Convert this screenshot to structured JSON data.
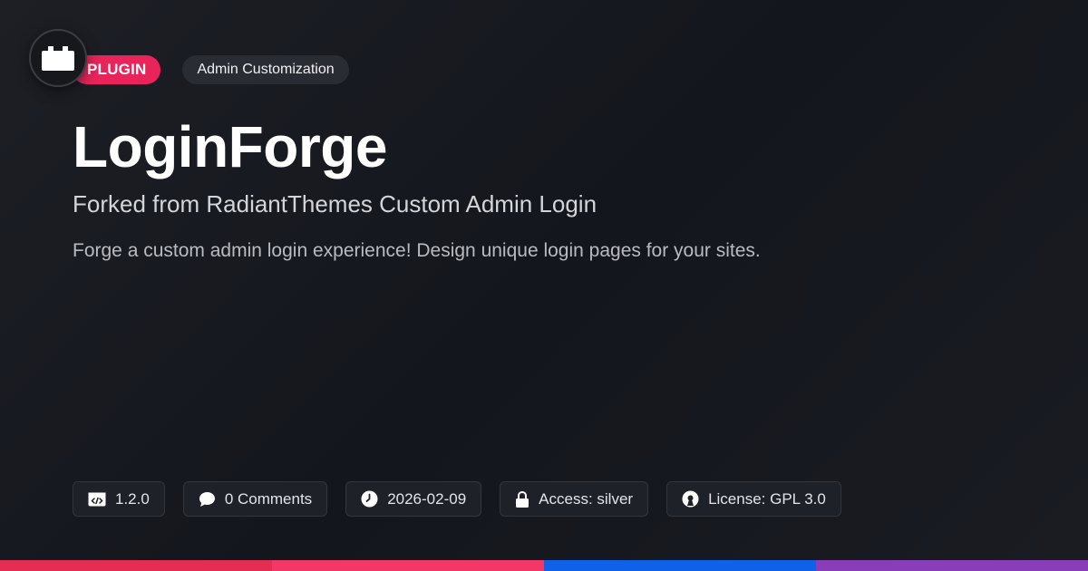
{
  "header": {
    "type_badge": "PLUGIN",
    "category_badge": "Admin Customization",
    "logo_icon": "plugin-block-icon"
  },
  "main": {
    "title": "LoginForge",
    "subtitle": "Forked from RadiantThemes Custom Admin Login",
    "description": "Forge a custom admin login experience! Design unique login pages for your sites."
  },
  "meta": {
    "version": "1.2.0",
    "comments": "0 Comments",
    "date": "2026-02-09",
    "access": "Access: silver",
    "license": "License: GPL 3.0"
  },
  "colors": {
    "accent": "#e8245a",
    "bar": [
      "#e52d54",
      "#f33868",
      "#0f62e8",
      "#8a3db8"
    ]
  }
}
